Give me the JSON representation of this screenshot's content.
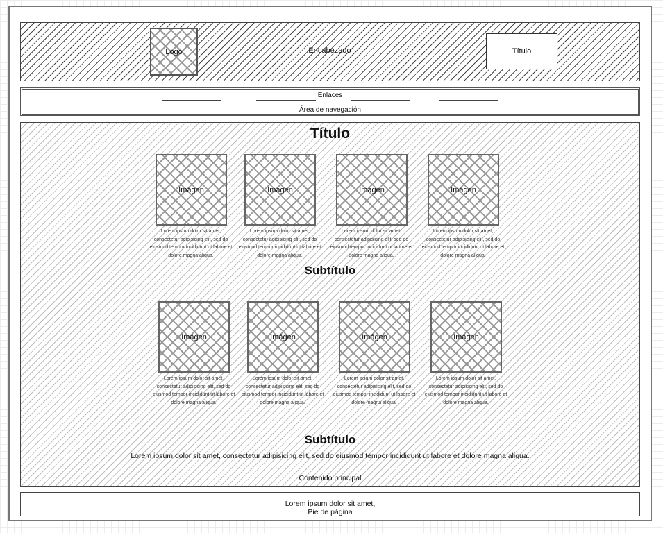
{
  "header": {
    "logo": "Logo",
    "label": "Encabezado",
    "title": "Título"
  },
  "nav": {
    "links_label": "Enlaces",
    "area_label": "Área de navegación",
    "link_count": 4
  },
  "main": {
    "title": "Título",
    "subtitle1": "Subtítulo",
    "subtitle2": "Subtítulo",
    "paragraph": "Lorem ipsum dolor sit amet, consectetur adipisicing elit, sed do eiusmod tempor incididunt ut labore et dolore magna aliqua.",
    "label": "Contenido principal",
    "row1": [
      {
        "image": "Imágen",
        "caption": "Lorem ipsum dolor sit amet, consectetur adipisicing elit, sed do eiusmod tempor incididunt ut labore et dolore magna aliqua."
      },
      {
        "image": "Imágen",
        "caption": "Lorem ipsum dolor sit amet, consectetur adipisicing elit, sed do eiusmod tempor incididunt ut labore et dolore magna aliqua."
      },
      {
        "image": "Imágen",
        "caption": "Lorem ipsum dolor sit amet, consectetur adipisicing elit, sed do eiusmod tempor incididunt ut labore et dolore magna aliqua."
      },
      {
        "image": "Imágen",
        "caption": "Lorem ipsum dolor sit amet, consectetur adipisicing elit, sed do eiusmod tempor incididunt ut labore et dolore magna aliqua."
      }
    ],
    "row2": [
      {
        "image": "Imágen",
        "caption": "Lorem ipsum dolor sit amet, consectetur adipisicing elit, sed do eiusmod tempor incididunt ut labore et dolore magna aliqua."
      },
      {
        "image": "Imágen",
        "caption": "Lorem ipsum dolor sit amet, consectetur adipisicing elit, sed do eiusmod tempor incididunt ut labore et dolore magna aliqua."
      },
      {
        "image": "Imágen",
        "caption": "Lorem ipsum dolor sit amet, consectetur adipisicing elit, sed do eiusmod tempor incididunt ut labore et dolore magna aliqua."
      },
      {
        "image": "Imágen",
        "caption": "Lorem ipsum dolor sit amet, consectetur adipisicing elit, sed do eiusmod tempor incididunt ut labore et dolore magna aliqua."
      }
    ]
  },
  "footer": {
    "text": "Lorem ipsum dolor sit amet,",
    "label": "Pie de página"
  }
}
